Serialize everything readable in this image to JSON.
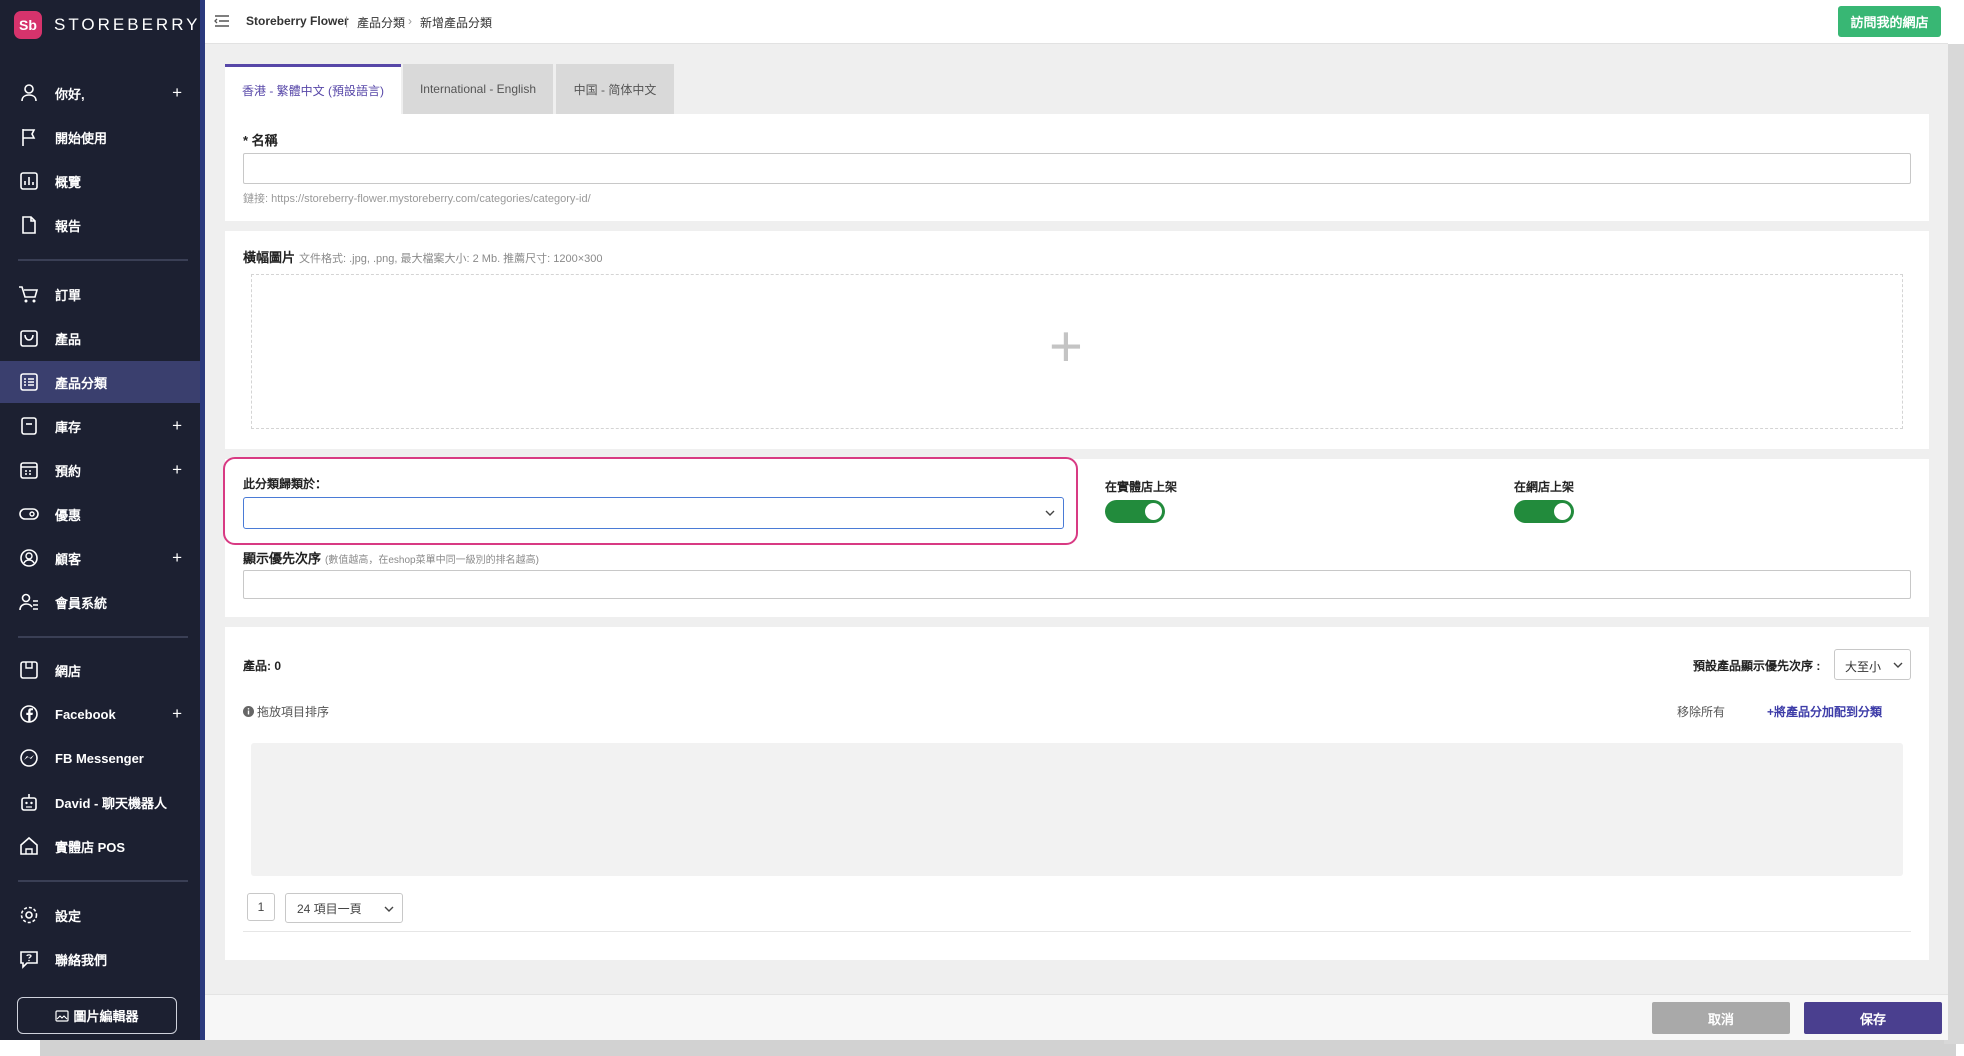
{
  "brand": {
    "name": "STOREBERRY",
    "mark": "Sb",
    "color": "#d6336c"
  },
  "sidebar": {
    "items": [
      {
        "label": "你好,",
        "icon": "user-icon",
        "expand": "+"
      },
      {
        "label": "開始使用",
        "icon": "flag-icon"
      },
      {
        "label": "概覽",
        "icon": "chart-icon"
      },
      {
        "label": "報告",
        "icon": "document-icon"
      },
      {
        "label": "訂單",
        "icon": "cart-icon"
      },
      {
        "label": "產品",
        "icon": "bag-icon"
      },
      {
        "label": "產品分類",
        "icon": "list-icon"
      },
      {
        "label": "庫存",
        "icon": "inventory-icon",
        "expand": "+"
      },
      {
        "label": "預約",
        "icon": "calendar-icon",
        "expand": "+"
      },
      {
        "label": "優惠",
        "icon": "ticket-icon"
      },
      {
        "label": "顧客",
        "icon": "customer-icon",
        "expand": "+"
      },
      {
        "label": "會員系統",
        "icon": "member-icon"
      },
      {
        "label": "網店",
        "icon": "store-icon"
      },
      {
        "label": "Facebook",
        "icon": "facebook-icon",
        "expand": "+"
      },
      {
        "label": "FB Messenger",
        "icon": "messenger-icon"
      },
      {
        "label": "David - 聊天機器人",
        "icon": "robot-icon"
      },
      {
        "label": "實體店 POS",
        "icon": "pos-icon"
      },
      {
        "label": "設定",
        "icon": "gear-icon"
      },
      {
        "label": "聯絡我們",
        "icon": "help-icon"
      }
    ],
    "image_editor": "圖片編輯器"
  },
  "topbar": {
    "breadcrumb": [
      "Storeberry Flower",
      "產品分類",
      "新增產品分類"
    ],
    "sep1": "|",
    "sep2": "›",
    "visit_button": "訪問我的網店"
  },
  "tabs": [
    "香港 - 繁體中文 (預設語言)",
    "International - English",
    "中国 - 简体中文"
  ],
  "name_section": {
    "label": "* 名稱",
    "value": "",
    "link_note": "鏈接: https://storeberry-flower.mystoreberry.com/categories/category-id/"
  },
  "banner_section": {
    "label": "橫幅圖片",
    "hint": "文件格式: .jpg, .png, 最大檔案大小: 2 Mb. 推薦尺寸: 1200×300",
    "plus": "+"
  },
  "category_section": {
    "parent_label": "此分類歸類於：",
    "parent_value": "",
    "store_toggle_label": "在實體店上架",
    "store_toggle_on": true,
    "online_toggle_label": "在網店上架",
    "online_toggle_on": true,
    "priority_label": "顯示優先次序",
    "priority_hint": "(數值越高，在eshop菜單中同一級別的排名越高)",
    "priority_value": ""
  },
  "products_section": {
    "count_label": "產品: 0",
    "sort_label": "預設產品顯示優先次序 :",
    "sort_value": "大至小",
    "drag_hint": "拖放項目排序",
    "remove_all": "移除所有",
    "assign_link": "+將產品分加配到分類",
    "page_number": "1",
    "per_page": "24 項目一頁"
  },
  "footer": {
    "cancel": "取消",
    "save": "保存"
  },
  "colors": {
    "sidebar_bg": "#1c2031",
    "accent": "#5747a8",
    "green": "#38b774",
    "highlight": "#d83a83"
  }
}
